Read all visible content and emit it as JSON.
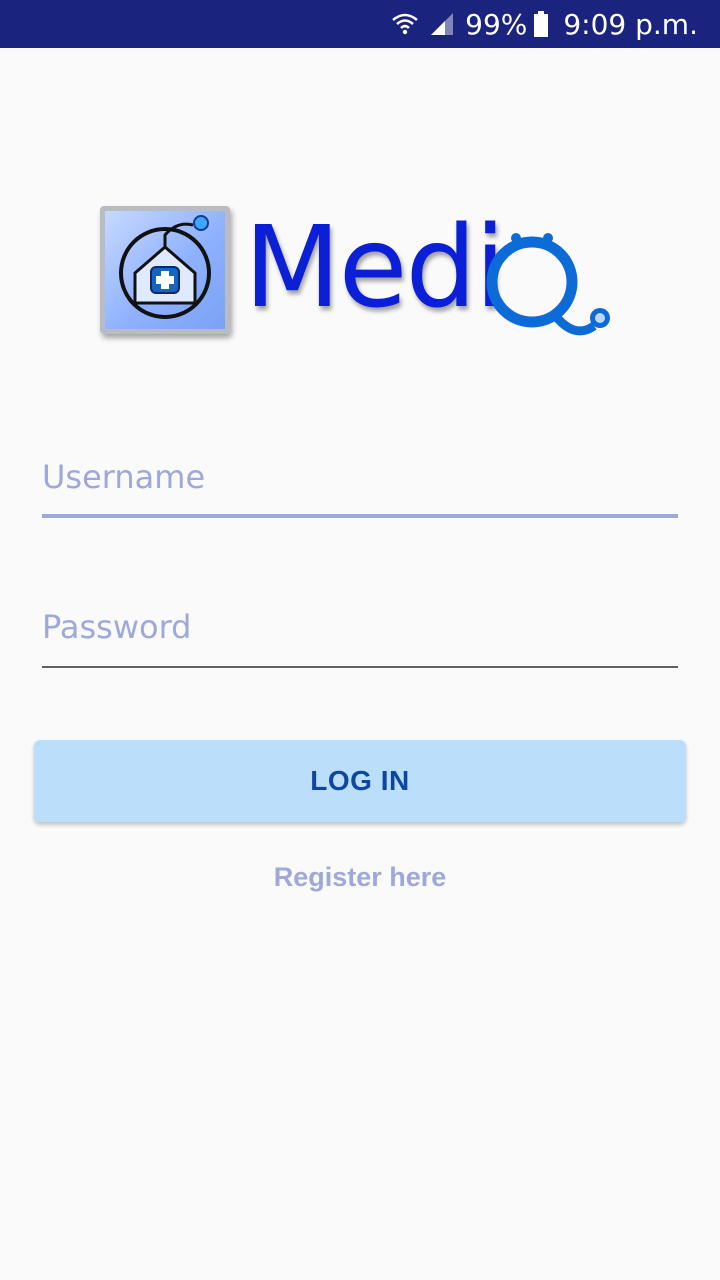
{
  "status_bar": {
    "battery": "99%",
    "time": "9:09 p.m.",
    "icons": [
      "wifi-icon",
      "signal-icon",
      "battery-icon"
    ]
  },
  "logo": {
    "text": "Medi",
    "accent_color": "#0a1fd6"
  },
  "form": {
    "username": {
      "placeholder": "Username",
      "value": ""
    },
    "password": {
      "placeholder": "Password",
      "value": ""
    },
    "login_label": "LOG IN",
    "register_label": "Register here"
  },
  "colors": {
    "status_bar_bg": "#1a237e",
    "accent": "#9fa8da",
    "button_bg": "#bbdefb",
    "button_text": "#0d47a1"
  }
}
